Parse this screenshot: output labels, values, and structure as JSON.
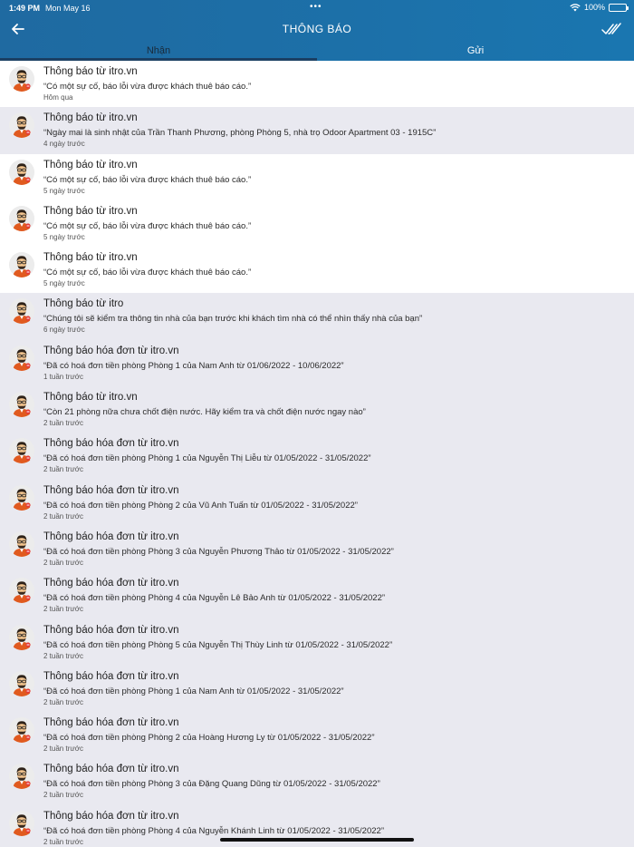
{
  "status_bar": {
    "time": "1:49 PM",
    "date": "Mon May 16",
    "dots": "•••",
    "battery": "100%"
  },
  "header": {
    "title": "THÔNG BÁO",
    "back_icon": "arrow-left-icon",
    "read_all_icon": "double-check-icon"
  },
  "tabs": [
    {
      "label": "Nhận",
      "active": true
    },
    {
      "label": "Gửi",
      "active": false
    }
  ],
  "colors": {
    "header": "#1d6ea6",
    "tab_indicator": "#1b3f63",
    "read_row": "#e9e9f0",
    "unread_row": "#ffffff"
  },
  "notifications": [
    {
      "title": "Thông báo từ itro.vn",
      "message": "“Có một sự cố, báo lỗi vừa được khách thuê báo cáo.”",
      "time": "Hôm qua",
      "read": false
    },
    {
      "title": "Thông báo từ itro.vn",
      "message": "“Ngày mai là sinh nhật của Trần Thanh Phương, phòng Phòng 5, nhà trọ Odoor Apartment 03 - 1915C”",
      "time": "4 ngày trước",
      "read": true
    },
    {
      "title": "Thông báo từ itro.vn",
      "message": "“Có một sự cố, báo lỗi vừa được khách thuê báo cáo.”",
      "time": "5 ngày trước",
      "read": false
    },
    {
      "title": "Thông báo từ itro.vn",
      "message": "“Có một sự cố, báo lỗi vừa được khách thuê báo cáo.”",
      "time": "5 ngày trước",
      "read": false
    },
    {
      "title": "Thông báo từ itro.vn",
      "message": "“Có một sự cố, báo lỗi vừa được khách thuê báo cáo.”",
      "time": "5 ngày trước",
      "read": false
    },
    {
      "title": "Thông báo từ itro",
      "message": "“Chúng tôi sẽ kiểm tra thông tin nhà của bạn trước khi khách tìm nhà có thể nhìn thấy nhà của bạn”",
      "time": "6 ngày trước",
      "read": true
    },
    {
      "title": "Thông báo hóa đơn từ itro.vn",
      "message": "“Đã có hoá đơn tiền phòng Phòng 1 của Nam Anh từ 01/06/2022 - 10/06/2022”",
      "time": "1 tuần trước",
      "read": true
    },
    {
      "title": "Thông báo từ itro.vn",
      "message": "“Còn 21 phòng nữa chưa chốt điện nước. Hãy kiểm tra và chốt điện nước ngay nào”",
      "time": "2 tuần trước",
      "read": true
    },
    {
      "title": "Thông báo hóa đơn từ itro.vn",
      "message": "“Đã có hoá đơn tiền phòng Phòng 1 của Nguyễn Thị Liễu từ 01/05/2022 - 31/05/2022”",
      "time": "2 tuần trước",
      "read": true
    },
    {
      "title": "Thông báo hóa đơn từ itro.vn",
      "message": "“Đã có hoá đơn tiền phòng Phòng 2 của Vũ Anh Tuấn từ 01/05/2022 - 31/05/2022”",
      "time": "2 tuần trước",
      "read": true
    },
    {
      "title": "Thông báo hóa đơn từ itro.vn",
      "message": "“Đã có hoá đơn tiền phòng Phòng 3 của Nguyễn Phương Thảo từ 01/05/2022 - 31/05/2022”",
      "time": "2 tuần trước",
      "read": true
    },
    {
      "title": "Thông báo hóa đơn từ itro.vn",
      "message": "“Đã có hoá đơn tiền phòng Phòng 4 của Nguyễn Lê Bảo Anh từ 01/05/2022 - 31/05/2022”",
      "time": "2 tuần trước",
      "read": true
    },
    {
      "title": "Thông báo hóa đơn từ itro.vn",
      "message": "“Đã có hoá đơn tiền phòng Phòng 5 của Nguyễn Thị Thùy Linh từ 01/05/2022 - 31/05/2022”",
      "time": "2 tuần trước",
      "read": true
    },
    {
      "title": "Thông báo hóa đơn từ itro.vn",
      "message": "“Đã có hoá đơn tiền phòng Phòng 1 của Nam Anh từ 01/05/2022 - 31/05/2022”",
      "time": "2 tuần trước",
      "read": true
    },
    {
      "title": "Thông báo hóa đơn từ itro.vn",
      "message": "“Đã có hoá đơn tiền phòng Phòng 2 của Hoàng Hương Ly từ 01/05/2022 - 31/05/2022”",
      "time": "2 tuần trước",
      "read": true
    },
    {
      "title": "Thông báo hóa đơn từ itro.vn",
      "message": "“Đã có hoá đơn tiền phòng Phòng 3 của Đặng Quang Dũng từ 01/05/2022 - 31/05/2022”",
      "time": "2 tuần trước",
      "read": true
    },
    {
      "title": "Thông báo hóa đơn từ itro.vn",
      "message": "“Đã có hoá đơn tiền phòng Phòng 4 của Nguyễn Khánh Linh từ 01/05/2022 - 31/05/2022”",
      "time": "2 tuần trước",
      "read": true
    }
  ]
}
